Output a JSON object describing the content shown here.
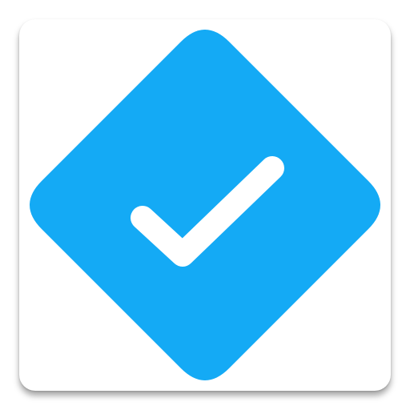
{
  "icon": {
    "name": "verified-check-badge",
    "diamond_icon": "diamond-icon",
    "check_icon": "checkmark-icon"
  },
  "colors": {
    "tile_background": "#ffffff",
    "diamond": "#14aaf5",
    "checkmark": "#ffffff"
  }
}
